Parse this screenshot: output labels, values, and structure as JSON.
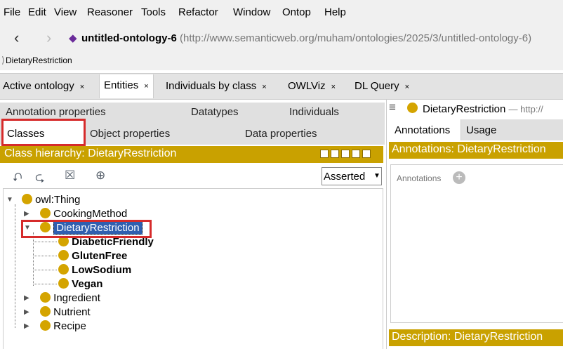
{
  "menu": [
    "File",
    "Edit",
    "View",
    "Reasoner",
    "Tools",
    "Refactor",
    "Window",
    "Ontop",
    "Help"
  ],
  "address": {
    "ontology_name": "untitled-ontology-6",
    "ontology_iri": "(http://www.semanticweb.org/muham/ontologies/2025/3/untitled-ontology-6)"
  },
  "breadcrumb": "DietaryRestriction",
  "tabs": [
    {
      "label": "Active ontology",
      "close": "×"
    },
    {
      "label": "Entities",
      "close": "×",
      "active": true
    },
    {
      "label": "Individuals by class",
      "close": "×"
    },
    {
      "label": "OWLViz",
      "close": "×"
    },
    {
      "label": "DL Query",
      "close": "×"
    }
  ],
  "left": {
    "subtabs_row1": [
      "Annotation properties",
      "Datatypes",
      "Individuals"
    ],
    "subtabs_row2": [
      "Classes",
      "Object properties",
      "Data properties"
    ],
    "header": "Class hierarchy: DietaryRestriction",
    "asserted": "Asserted",
    "tree": {
      "root": "owl:Thing",
      "cooking_method": "CookingMethod",
      "dietary_restriction": "DietaryRestriction",
      "children": [
        "DiabeticFriendly",
        "GlutenFree",
        "LowSodium",
        "Vegan"
      ],
      "ingredient": "Ingredient",
      "nutrient": "Nutrient",
      "recipe": "Recipe"
    }
  },
  "right": {
    "title": "DietaryRestriction",
    "title_suffix": "— http://",
    "tabs": [
      "Annotations",
      "Usage"
    ],
    "annotations_header": "Annotations: DietaryRestriction",
    "annotations_label": "Annotations",
    "description_header": "Description: DietaryRestriction"
  },
  "colors": {
    "accent": "#c9a100",
    "class_dot": "#d4a400",
    "selection": "#2f5fb0",
    "highlight": "#d62b2b"
  }
}
